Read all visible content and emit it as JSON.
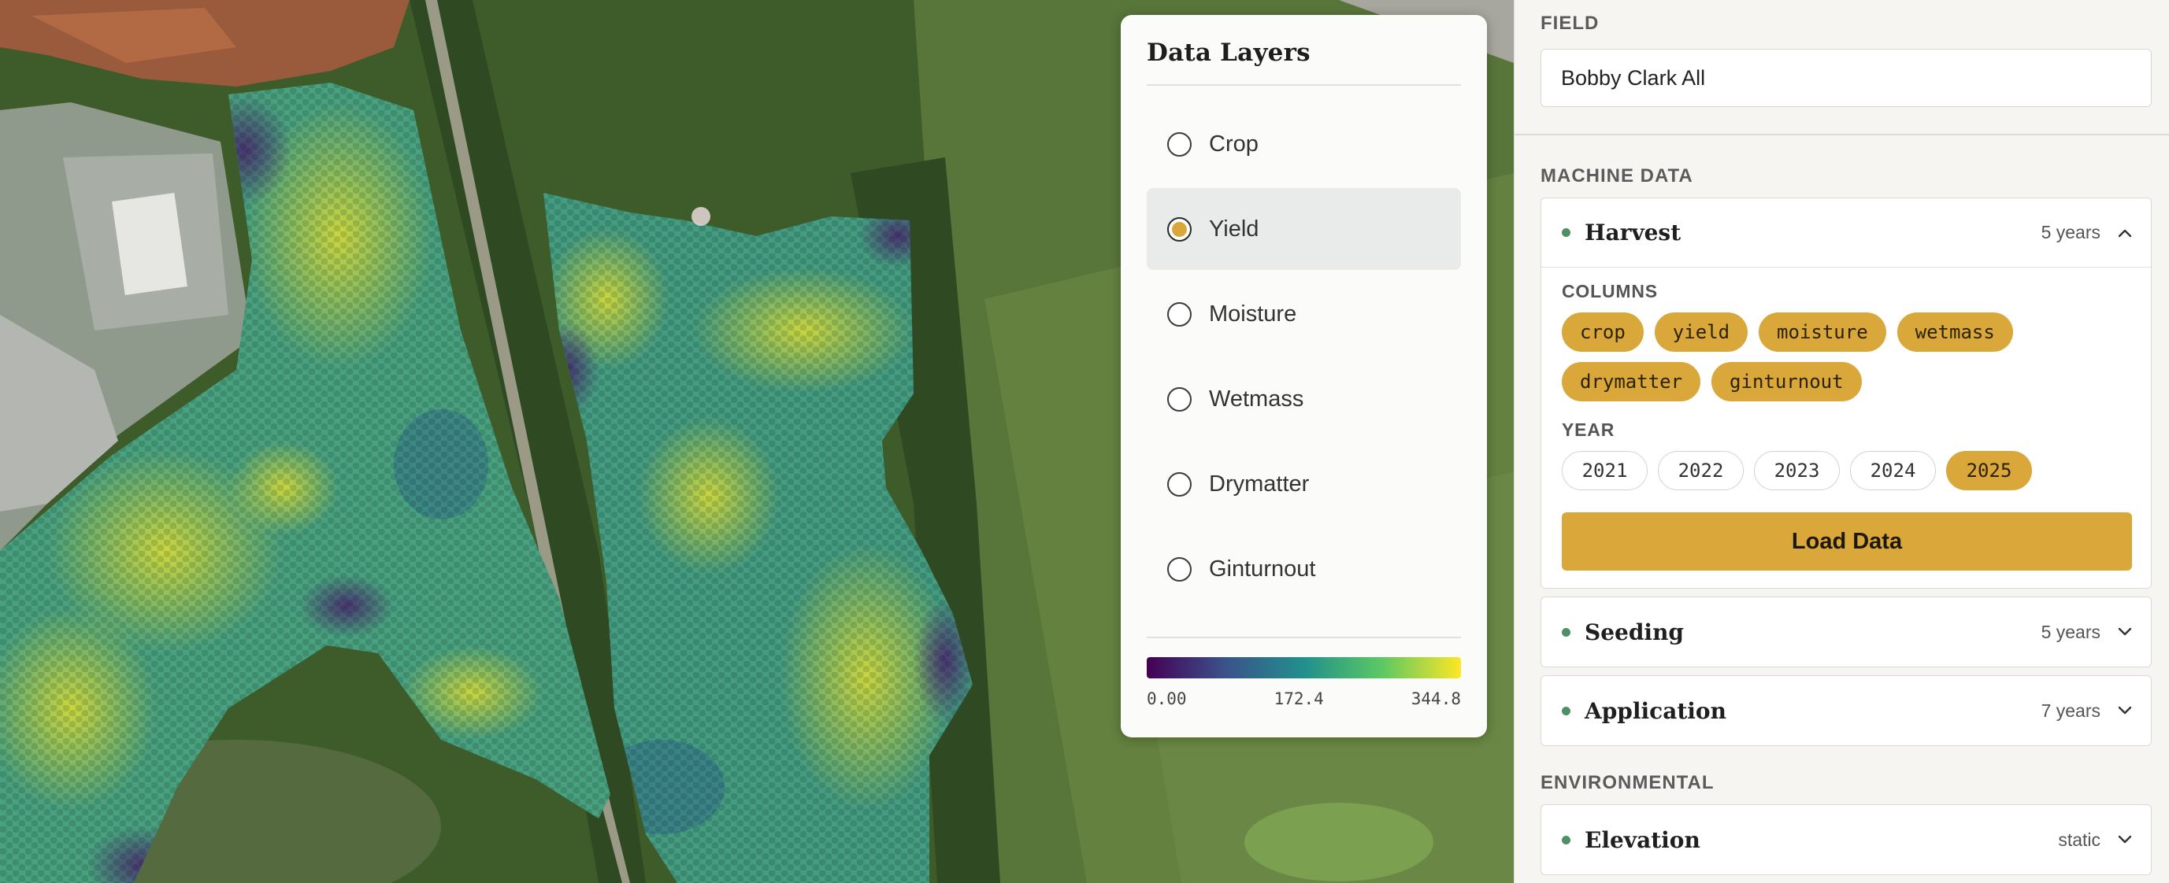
{
  "layers_panel": {
    "title": "Data Layers",
    "items": [
      {
        "label": "Crop",
        "selected": false
      },
      {
        "label": "Yield",
        "selected": true
      },
      {
        "label": "Moisture",
        "selected": false
      },
      {
        "label": "Wetmass",
        "selected": false
      },
      {
        "label": "Drymatter",
        "selected": false
      },
      {
        "label": "Ginturnout",
        "selected": false
      }
    ],
    "legend": {
      "min": "0.00",
      "mid": "172.4",
      "max": "344.8"
    }
  },
  "sidebar": {
    "field_label": "FIELD",
    "field_value": "Bobby Clark All",
    "machine_label": "MACHINE DATA",
    "harvest": {
      "title": "Harvest",
      "meta": "5 years",
      "columns_label": "COLUMNS",
      "columns": [
        "crop",
        "yield",
        "moisture",
        "wetmass",
        "drymatter",
        "ginturnout"
      ],
      "year_label": "YEAR",
      "years": [
        "2021",
        "2022",
        "2023",
        "2024",
        "2025"
      ],
      "active_year": "2025",
      "load_label": "Load Data"
    },
    "seeding": {
      "title": "Seeding",
      "meta": "5 years"
    },
    "application": {
      "title": "Application",
      "meta": "7 years"
    },
    "env_label": "ENVIRONMENTAL",
    "elevation": {
      "title": "Elevation",
      "meta": "static"
    }
  },
  "colors": {
    "accent": "#d9a73a",
    "dot": "#4e8f63",
    "panel": "#fbfbfa",
    "sidebar": "#f6f5f2"
  },
  "icons": {
    "collapse": "chevron-up-icon",
    "expand": "chevron-down-icon",
    "status": "status-dot-icon"
  }
}
